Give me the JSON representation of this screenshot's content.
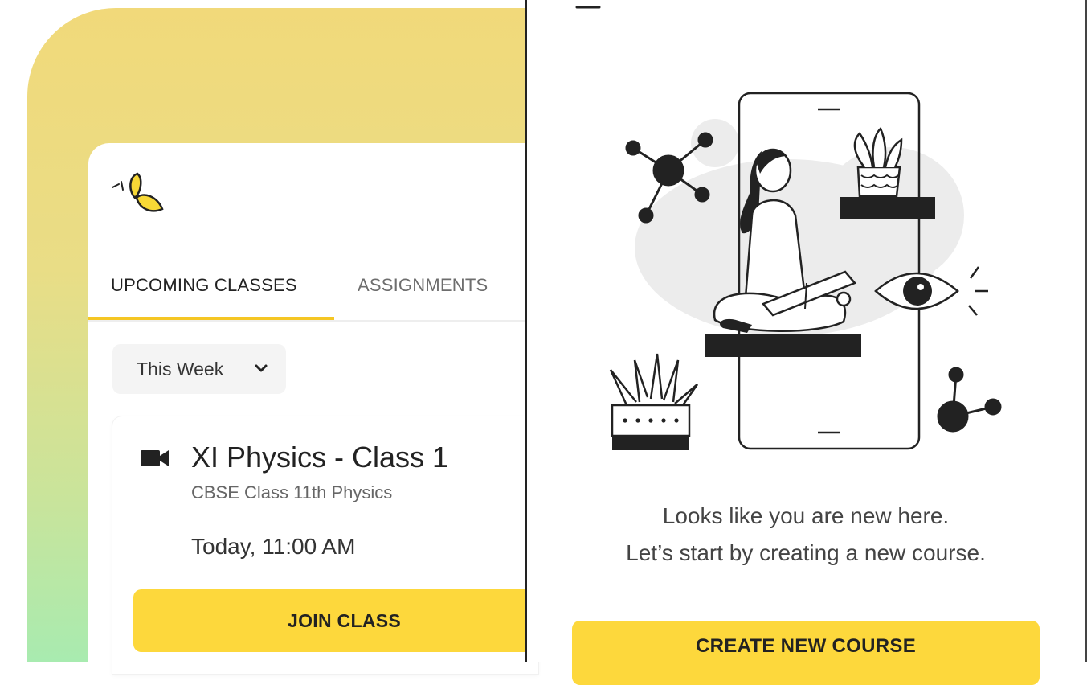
{
  "tabs": {
    "upcoming": "UPCOMING CLASSES",
    "assignments": "ASSIGNMENTS"
  },
  "filter": {
    "selected": "This Week"
  },
  "class_card": {
    "title": "XI Physics - Class 1",
    "subtitle": "CBSE Class 11th Physics",
    "time": "Today, 11:00 AM",
    "join_label": "JOIN CLASS"
  },
  "empty_state": {
    "line1": "Looks like you are new here.",
    "line2": "Let’s start by creating a new course.",
    "create_label": "CREATE NEW COURSE"
  },
  "icons": {
    "logo": "leaf-logo-icon",
    "camera": "video-camera-icon",
    "dropdown": "chevron-down-icon"
  },
  "colors": {
    "accent": "#fdd83c",
    "tab_indicator": "#f5c623",
    "gradient_top": "#f1d97a",
    "gradient_bottom": "#a8ebb0"
  }
}
